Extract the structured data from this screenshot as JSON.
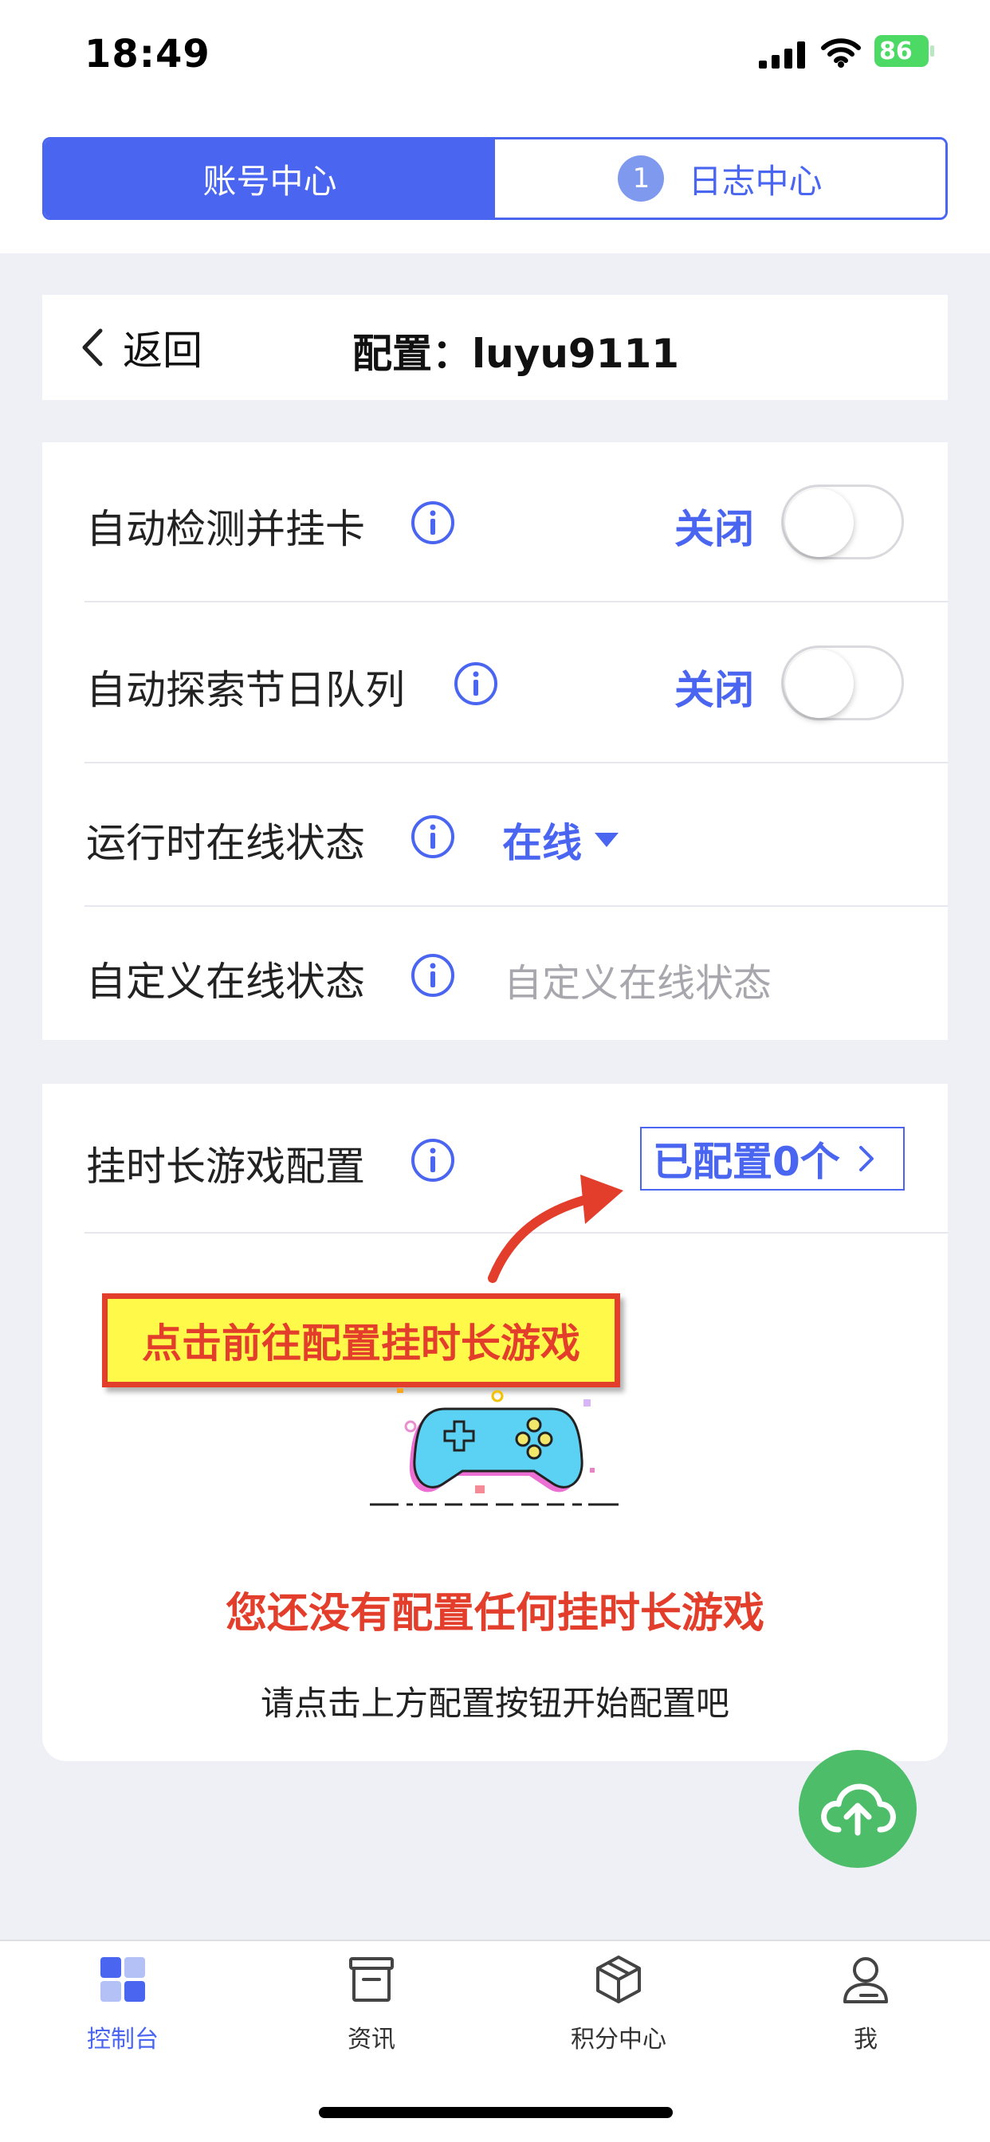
{
  "status_bar": {
    "time": "18:49",
    "battery": "86"
  },
  "tabs_top": [
    {
      "label": "账号中心",
      "active": true
    },
    {
      "label": "日志中心",
      "active": false,
      "badge": "1"
    }
  ],
  "nav": {
    "back_label": "返回",
    "title": "配置：luyu9111"
  },
  "settings": [
    {
      "label": "自动检测并挂卡",
      "state_label": "关闭",
      "toggle_on": false
    },
    {
      "label": "自动探索节日队列",
      "state_label": "关闭",
      "toggle_on": false
    },
    {
      "label": "运行时在线状态",
      "dropdown_value": "在线"
    },
    {
      "label": "自定义在线状态",
      "input_placeholder": "自定义在线状态",
      "input_value": ""
    }
  ],
  "game_config": {
    "label": "挂时长游戏配置",
    "configured_label": "已配置0个",
    "callout": "点击前往配置挂时长游戏",
    "empty_title": "您还没有配置任何挂时长游戏",
    "empty_subtitle": "请点击上方配置按钮开始配置吧"
  },
  "bottom_tabs": [
    {
      "label": "控制台",
      "icon": "dashboard-icon",
      "active": true
    },
    {
      "label": "资讯",
      "icon": "news-icon",
      "active": false
    },
    {
      "label": "积分中心",
      "icon": "box-icon",
      "active": false
    },
    {
      "label": "我",
      "icon": "profile-icon",
      "active": false
    }
  ],
  "colors": {
    "accent": "#4a66f0",
    "alert": "#e23e2b",
    "fab": "#4dbd6a",
    "callout_bg": "#fff94a"
  }
}
